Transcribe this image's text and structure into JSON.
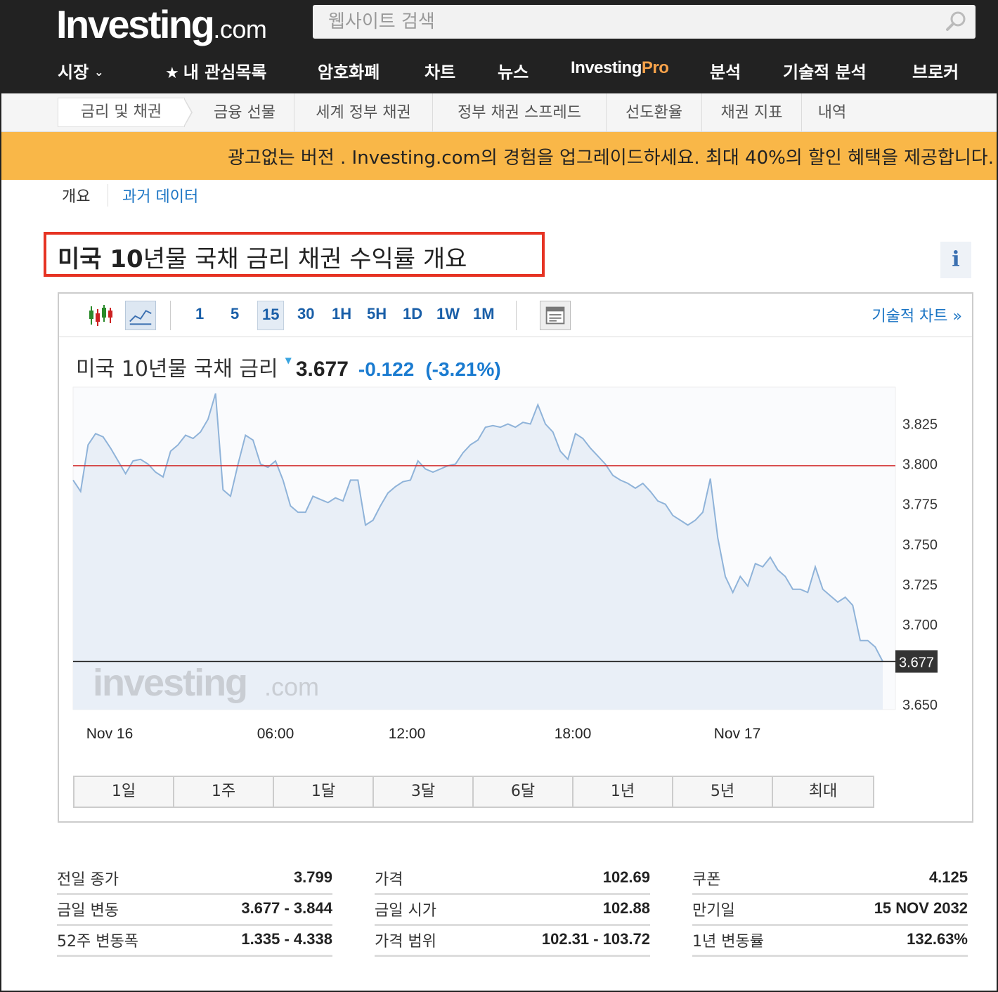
{
  "header": {
    "logo_main": "Investing",
    "logo_suffix": ".com",
    "search_placeholder": "웹사이트 검색"
  },
  "nav": {
    "markets": "시장",
    "watchlist": "내 관심목록",
    "crypto": "암호화폐",
    "charts": "차트",
    "news": "뉴스",
    "pro_main": "Investing",
    "pro_suffix": "Pro",
    "analysis": "분석",
    "technical": "기술적 분석",
    "brokers": "브로커"
  },
  "subnav": [
    "금리 및 채권",
    "금융 선물",
    "세계 정부 채권",
    "정부 채권 스프레드",
    "선도환율",
    "채권 지표",
    "내역"
  ],
  "promo": "광고없는 버전 . Investing.com의 경험을 업그레이드하세요. 최대 40%의 할인 혜택을 제공합니다.",
  "tabs": {
    "overview": "개요",
    "history": "과거 데이터"
  },
  "title": {
    "bold": "미국 10",
    "rest": "년물 국채 금리  채권 수익률 개요"
  },
  "info_icon": "i",
  "toolbar": {
    "intervals": [
      "1",
      "5",
      "15",
      "30",
      "1H",
      "5H",
      "1D",
      "1W",
      "1M"
    ],
    "active_interval": "15",
    "tech_chart_link": "기술적 차트 »"
  },
  "quote": {
    "name": "미국 10년물 국채 금리",
    "price": "3.677",
    "change": "-0.122",
    "change_pct": "(-3.21%)"
  },
  "ranges": [
    "1일",
    "1주",
    "1달",
    "3달",
    "6달",
    "1년",
    "5년",
    "최대"
  ],
  "colors": {
    "header_bg": "#222222",
    "promo_bg": "#f9b748",
    "link_blue": "#1a74c4",
    "line_blue": "#8fb3d9",
    "area_fill": "#e9eff7",
    "prev_close_red": "#d22b2b",
    "title_box_red": "#e63323"
  },
  "stats": {
    "col1": [
      {
        "label": "전일 종가",
        "value": "3.799"
      },
      {
        "label": "금일 변동",
        "value": "3.677 - 3.844"
      },
      {
        "label": "52주 변동폭",
        "value": "1.335 - 4.338"
      }
    ],
    "col2": [
      {
        "label": "가격",
        "value": "102.69"
      },
      {
        "label": "금일 시가",
        "value": "102.88"
      },
      {
        "label": "가격 범위",
        "value": "102.31 - 103.72"
      }
    ],
    "col3": [
      {
        "label": "쿠폰",
        "value": "4.125"
      },
      {
        "label": "만기일",
        "value": "15 NOV 2032"
      },
      {
        "label": "1년 변동률",
        "value": "132.63%"
      }
    ]
  },
  "chart_data": {
    "type": "area",
    "title": "미국 10년물 국채 금리",
    "x_ticks": [
      "Nov 16",
      "06:00",
      "12:00",
      "18:00",
      "Nov 17"
    ],
    "y_ticks": [
      3.825,
      3.8,
      3.775,
      3.75,
      3.725,
      3.7,
      3.65
    ],
    "ylim": [
      3.647,
      3.848
    ],
    "prev_close": 3.799,
    "last_price_label": "3.677",
    "watermark_main": "investing",
    "watermark_suffix": ".com",
    "grid": false,
    "series": [
      {
        "values": [
          3.79,
          3.783,
          3.812,
          3.819,
          3.817,
          3.81,
          3.802,
          3.794,
          3.802,
          3.803,
          3.8,
          3.795,
          3.792,
          3.808,
          3.812,
          3.818,
          3.816,
          3.82,
          3.828,
          3.844,
          3.784,
          3.78,
          3.8,
          3.818,
          3.815,
          3.8,
          3.798,
          3.802,
          3.79,
          3.774,
          3.77,
          3.77,
          3.78,
          3.778,
          3.776,
          3.779,
          3.777,
          3.79,
          3.79,
          3.762,
          3.765,
          3.774,
          3.782,
          3.786,
          3.789,
          3.79,
          3.802,
          3.797,
          3.795,
          3.797,
          3.799,
          3.8,
          3.807,
          3.812,
          3.815,
          3.823,
          3.824,
          3.823,
          3.825,
          3.823,
          3.826,
          3.825,
          3.837,
          3.825,
          3.82,
          3.808,
          3.803,
          3.819,
          3.816,
          3.81,
          3.805,
          3.8,
          3.793,
          3.79,
          3.788,
          3.785,
          3.788,
          3.783,
          3.777,
          3.775,
          3.768,
          3.765,
          3.762,
          3.765,
          3.77,
          3.791,
          3.754,
          3.73,
          3.72,
          3.73,
          3.724,
          3.738,
          3.736,
          3.742,
          3.734,
          3.73,
          3.722,
          3.722,
          3.72,
          3.736,
          3.722,
          3.718,
          3.714,
          3.717,
          3.712,
          3.69,
          3.69,
          3.686,
          3.677
        ]
      }
    ]
  }
}
